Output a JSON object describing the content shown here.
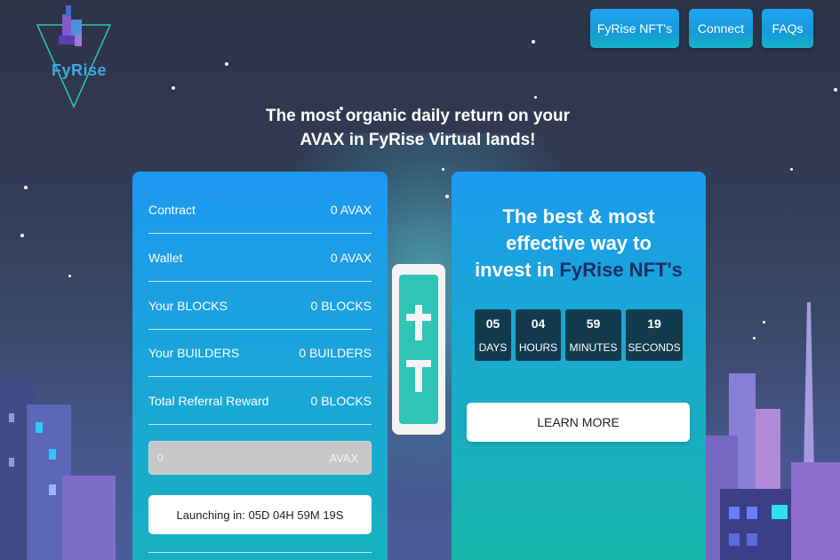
{
  "brand": {
    "name": "FyRise"
  },
  "nav": {
    "nft_label": "FyRise NFT's",
    "connect_label": "Connect",
    "faqs_label": "FAQs"
  },
  "headline": {
    "line1": "The most organic daily return on your",
    "line2": "AVAX in FyRise Virtual lands!"
  },
  "stats": [
    {
      "label": "Contract",
      "value": "0 AVAX"
    },
    {
      "label": "Wallet",
      "value": "0 AVAX"
    },
    {
      "label": "Your BLOCKS",
      "value": "0 BLOCKS"
    },
    {
      "label": "Your BUILDERS",
      "value": "0 BUILDERS"
    },
    {
      "label": "Total Referral Reward",
      "value": "0 BLOCKS"
    }
  ],
  "amount_input": {
    "value": "0",
    "unit": "AVAX"
  },
  "launch_button": {
    "label": "Launching in: 05D 04H 59M 19S"
  },
  "promo": {
    "line1": "The best & most",
    "line2": "effective way to",
    "line3_prefix": "invest in ",
    "line3_accent": "FyRise NFT's"
  },
  "countdown": [
    {
      "value": "05",
      "label": "DAYS"
    },
    {
      "value": "04",
      "label": "HOURS"
    },
    {
      "value": "59",
      "label": "MINUTES"
    },
    {
      "value": "19",
      "label": "SECONDS"
    }
  ],
  "learn_more": {
    "label": "LEARN MORE"
  },
  "colors": {
    "panel_blue": "#1d98f2",
    "panel_teal": "#17b0bf",
    "accent_navy": "#1b2f64",
    "countdown_box": "#123b4e"
  }
}
